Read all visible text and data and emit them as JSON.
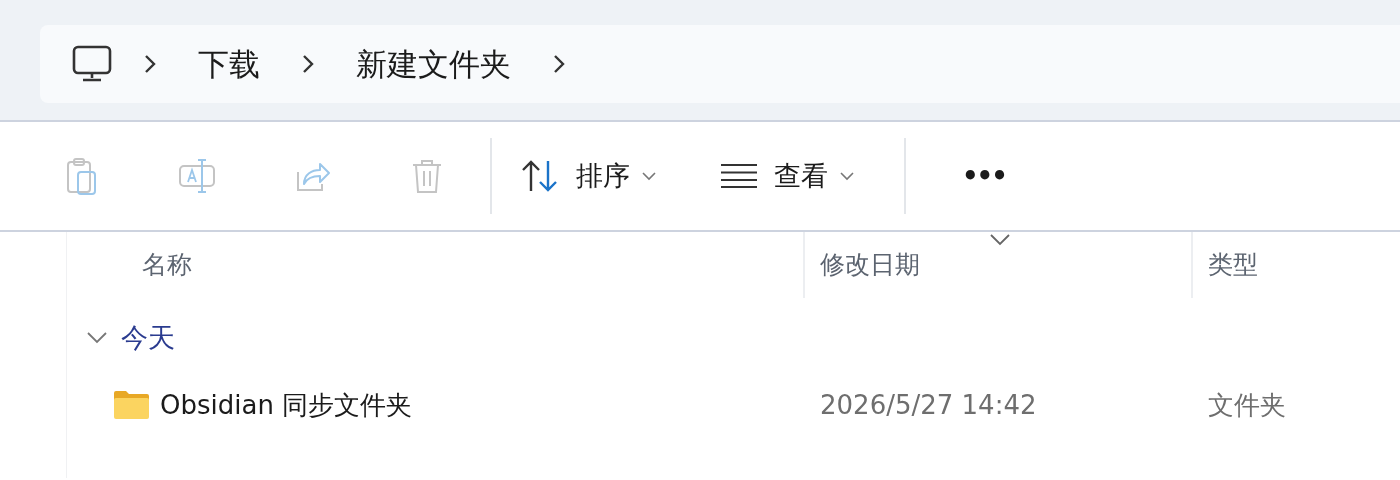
{
  "breadcrumb": {
    "items": [
      {
        "label": "下载"
      },
      {
        "label": "新建文件夹"
      }
    ]
  },
  "toolbar": {
    "actions": [
      {
        "kind": "paste",
        "disabled": true
      },
      {
        "kind": "rename",
        "disabled": true
      },
      {
        "kind": "share",
        "disabled": true
      },
      {
        "kind": "delete",
        "disabled": true
      }
    ],
    "menus": [
      {
        "kind": "sort",
        "label": "排序"
      },
      {
        "kind": "view",
        "label": "查看"
      }
    ],
    "more": {
      "label": "•••"
    }
  },
  "table": {
    "columns": [
      {
        "label": "名称",
        "sorted": false
      },
      {
        "label": "修改日期",
        "sorted": true
      },
      {
        "label": "类型",
        "sorted": false
      }
    ],
    "groups": [
      {
        "label": "今天",
        "expanded": true,
        "rows": [
          {
            "name": "Obsidian 同步文件夹",
            "modified": "2026/5/27 14:42",
            "type": "文件夹"
          }
        ]
      }
    ]
  }
}
